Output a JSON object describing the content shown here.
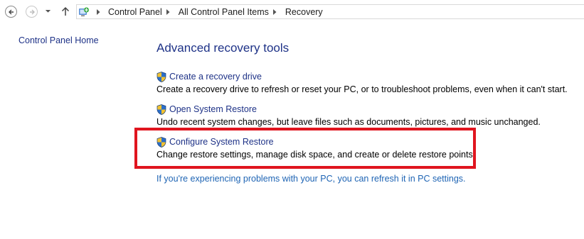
{
  "navigation": {
    "back_icon": "back-arrow-icon",
    "forward_icon": "forward-arrow-icon",
    "recent_icon": "chevron-down-icon",
    "up_icon": "up-arrow-icon"
  },
  "address_bar": {
    "icon": "control-panel-icon",
    "breadcrumbs": [
      "Control Panel",
      "All Control Panel Items",
      "Recovery"
    ]
  },
  "sidebar": {
    "home_link": "Control Panel Home"
  },
  "main": {
    "title": "Advanced recovery tools",
    "tools": [
      {
        "icon": "uac-shield-icon",
        "label": "Create a recovery drive",
        "description": "Create a recovery drive to refresh or reset your PC, or to troubleshoot problems, even when it can't start."
      },
      {
        "icon": "uac-shield-icon",
        "label": "Open System Restore",
        "description": "Undo recent system changes, but leave files such as documents, pictures, and music unchanged."
      },
      {
        "icon": "uac-shield-icon",
        "label": "Configure System Restore",
        "description": "Change restore settings, manage disk space, and create or delete restore points."
      }
    ],
    "footer_link": "If you're experiencing problems with your PC, you can refresh it in PC settings."
  },
  "colors": {
    "link": "#1e3287",
    "footer_link": "#1e64b4",
    "highlight_box": "#e0151f"
  }
}
